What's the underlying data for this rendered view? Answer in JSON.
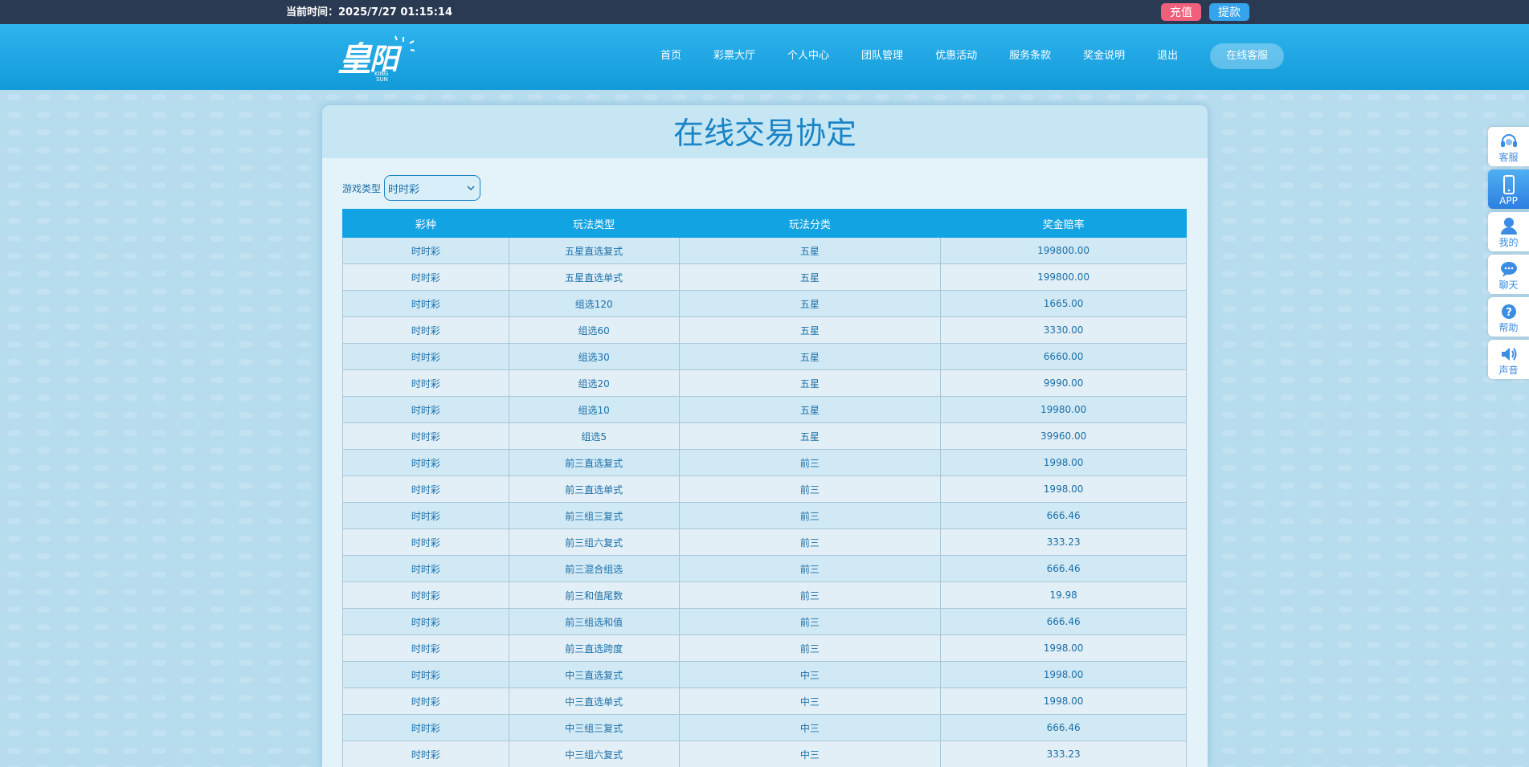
{
  "topbar": {
    "time_label": "当前时间：2025/7/27 01:15:14",
    "recharge": "充值",
    "withdraw": "提款"
  },
  "header": {
    "logo_text": "皇阳",
    "logo_sub": "KING SUN",
    "nav": [
      "首页",
      "彩票大厅",
      "个人中心",
      "团队管理",
      "优惠活动",
      "服务条款",
      "奖金说明",
      "退出",
      "在线客服"
    ]
  },
  "page": {
    "title": "在线交易协定",
    "filter_label": "游戏类型",
    "filter_value": "时时彩"
  },
  "table": {
    "headers": [
      "彩种",
      "玩法类型",
      "玩法分类",
      "奖金赔率"
    ],
    "rows": [
      [
        "时时彩",
        "五星直选复式",
        "五星",
        "199800.00"
      ],
      [
        "时时彩",
        "五星直选单式",
        "五星",
        "199800.00"
      ],
      [
        "时时彩",
        "组选120",
        "五星",
        "1665.00"
      ],
      [
        "时时彩",
        "组选60",
        "五星",
        "3330.00"
      ],
      [
        "时时彩",
        "组选30",
        "五星",
        "6660.00"
      ],
      [
        "时时彩",
        "组选20",
        "五星",
        "9990.00"
      ],
      [
        "时时彩",
        "组选10",
        "五星",
        "19980.00"
      ],
      [
        "时时彩",
        "组选5",
        "五星",
        "39960.00"
      ],
      [
        "时时彩",
        "前三直选复式",
        "前三",
        "1998.00"
      ],
      [
        "时时彩",
        "前三直选单式",
        "前三",
        "1998.00"
      ],
      [
        "时时彩",
        "前三组三复式",
        "前三",
        "666.46"
      ],
      [
        "时时彩",
        "前三组六复式",
        "前三",
        "333.23"
      ],
      [
        "时时彩",
        "前三混合组选",
        "前三",
        "666.46"
      ],
      [
        "时时彩",
        "前三和值尾数",
        "前三",
        "19.98"
      ],
      [
        "时时彩",
        "前三组选和值",
        "前三",
        "666.46"
      ],
      [
        "时时彩",
        "前三直选跨度",
        "前三",
        "1998.00"
      ],
      [
        "时时彩",
        "中三直选复式",
        "中三",
        "1998.00"
      ],
      [
        "时时彩",
        "中三直选单式",
        "中三",
        "1998.00"
      ],
      [
        "时时彩",
        "中三组三复式",
        "中三",
        "666.46"
      ],
      [
        "时时彩",
        "中三组六复式",
        "中三",
        "333.23"
      ]
    ]
  },
  "float": {
    "items": [
      {
        "label": "客服",
        "icon": "headset-icon"
      },
      {
        "label": "APP",
        "icon": "phone-icon"
      },
      {
        "label": "我的",
        "icon": "user-icon"
      },
      {
        "label": "聊天",
        "icon": "chat-icon"
      },
      {
        "label": "帮助",
        "icon": "help-icon"
      },
      {
        "label": "声音",
        "icon": "speaker-icon"
      }
    ]
  },
  "colors": {
    "topbar": "#2a3a52",
    "header": "#1ea7e6",
    "accent": "#12a3e2",
    "recharge": "#f0607a",
    "withdraw": "#35a4ec"
  }
}
